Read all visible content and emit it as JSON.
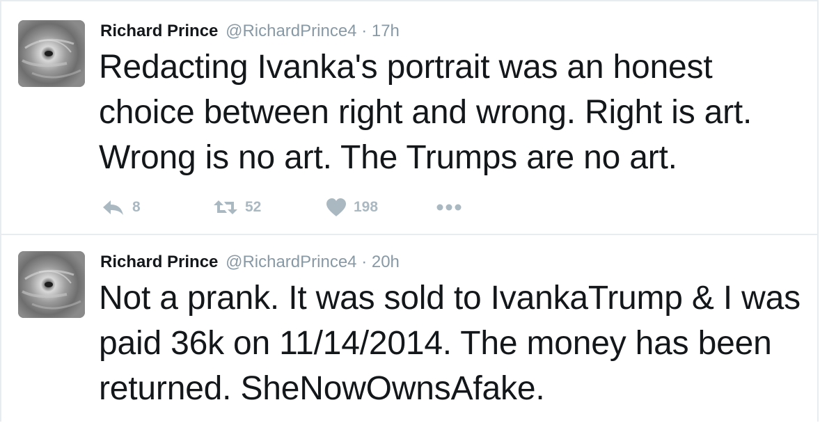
{
  "tweets": [
    {
      "fullname": "Richard Prince",
      "username": "@RichardPrince4",
      "separator": "·",
      "time": "17h",
      "text": "Redacting Ivanka's portrait was an honest choice between right and wrong. Right is art. Wrong is no art. The Trumps are no art.",
      "reply_count": "8",
      "retweet_count": "52",
      "like_count": "198"
    },
    {
      "fullname": "Richard Prince",
      "username": "@RichardPrince4",
      "separator": "·",
      "time": "20h",
      "text": "Not a prank. It was sold to IvankaTrump & I was paid 36k on 11/14/2014. The money has been returned. SheNowOwnsAfake."
    }
  ],
  "icons": {
    "reply": "reply-icon",
    "retweet": "retweet-icon",
    "like": "heart-icon",
    "more": "more-dots-icon",
    "avatar": "hurricane-avatar"
  },
  "colors": {
    "text": "#14171a",
    "secondary": "#8899a6",
    "action": "#aab8c2",
    "divider": "#e6ecf0"
  }
}
